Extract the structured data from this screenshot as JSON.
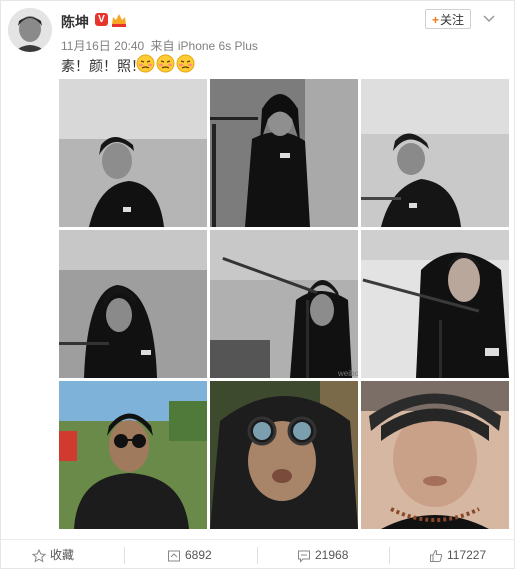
{
  "author": {
    "name": "陈坤"
  },
  "post": {
    "timestamp": "11月16日 20:40",
    "source": "来自 iPhone 6s Plus",
    "text": "素！颜！照！",
    "emoji_icon": "embarrassed-face-icon",
    "emoji_count": 3,
    "photo_count": 9,
    "watermark": "weibo"
  },
  "follow_button": {
    "label": "关注"
  },
  "actions": {
    "favorite": {
      "label": "收藏"
    },
    "repost": {
      "count": "6892"
    },
    "comment": {
      "count": "21968"
    },
    "like": {
      "count": "117227"
    }
  },
  "colors": {
    "accent": "#f57a15",
    "verified": "#e5352c",
    "text": "#333333",
    "meta": "#808080"
  }
}
